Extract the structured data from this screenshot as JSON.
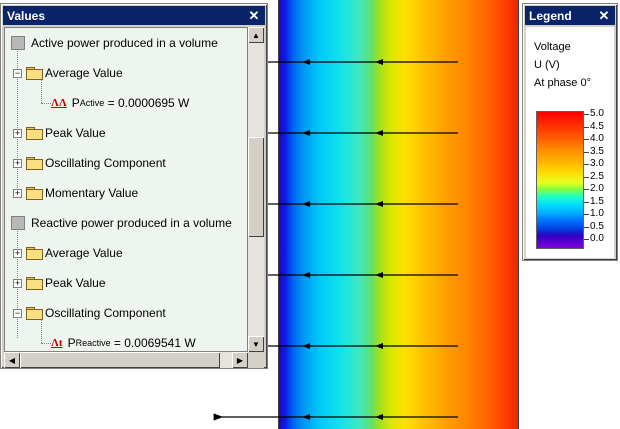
{
  "values_window": {
    "title": "Values",
    "tree": [
      {
        "kind": "group",
        "label": "Active power produced in a volume"
      },
      {
        "kind": "folder",
        "expander": "−",
        "label": "Average Value"
      },
      {
        "kind": "quantity",
        "icon_text": "ΛΛ",
        "symbol": "P",
        "subscript": "Active",
        "value": " = 0.0000695 W"
      },
      {
        "kind": "folder",
        "expander": "+",
        "label": "Peak Value"
      },
      {
        "kind": "folder",
        "expander": "+",
        "label": "Oscillating Component"
      },
      {
        "kind": "folder",
        "expander": "+",
        "label": "Momentary Value"
      },
      {
        "kind": "group",
        "label": "Reactive power produced in a volume"
      },
      {
        "kind": "folder",
        "expander": "+",
        "label": "Average Value"
      },
      {
        "kind": "folder",
        "expander": "+",
        "label": "Peak Value"
      },
      {
        "kind": "folder",
        "expander": "−",
        "label": "Oscillating Component"
      },
      {
        "kind": "quantity",
        "icon_text": "Λt",
        "symbol": "P",
        "subscript": "Reactive",
        "value": " = 0.0069541 W"
      }
    ]
  },
  "legend_window": {
    "title": "Legend",
    "quantity": "Voltage",
    "unit": "U (V)",
    "phase": "At phase 0°",
    "scale_labels": [
      "5.0",
      "4.5",
      "4.0",
      "3.5",
      "3.0",
      "2.5",
      "2.0",
      "1.5",
      "1.0",
      "0.5",
      "0.0"
    ]
  },
  "icons": {
    "close": "✕",
    "scroll_up": "▲",
    "scroll_down": "▼",
    "scroll_left": "◀",
    "scroll_right": "▶"
  },
  "colors": {
    "titlebar": "#0a246a",
    "tree_background": "#eef5ee"
  }
}
